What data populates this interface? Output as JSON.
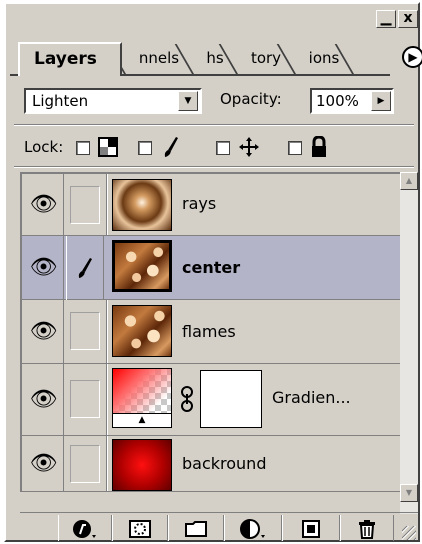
{
  "window": {
    "minimize_label": "▁",
    "close_label": "x"
  },
  "tabs": [
    {
      "label": "Layers"
    },
    {
      "label": "nnels"
    },
    {
      "label": "hs"
    },
    {
      "label": "tory"
    },
    {
      "label": "ions"
    }
  ],
  "panel_menu_icon": "triangle-right-icon",
  "blend_mode": {
    "value": "Lighten"
  },
  "opacity": {
    "label": "Opacity:",
    "value": "100%"
  },
  "lock": {
    "label": "Lock:",
    "options": [
      {
        "icon": "transparency-grid-icon",
        "checked": false
      },
      {
        "icon": "brush-icon",
        "checked": false
      },
      {
        "icon": "move-arrows-icon",
        "checked": false
      },
      {
        "icon": "padlock-icon",
        "checked": false
      }
    ]
  },
  "layers": [
    {
      "name": "rays",
      "visible": true,
      "selected": false
    },
    {
      "name": "center",
      "visible": true,
      "selected": true,
      "brush": true
    },
    {
      "name": "flames",
      "visible": true,
      "selected": false
    },
    {
      "name": "Gradien...",
      "visible": true,
      "selected": false,
      "linked_mask": true
    },
    {
      "name": "backround",
      "visible": true,
      "selected": false
    }
  ],
  "toolbar": [
    {
      "icon": "layer-style-icon"
    },
    {
      "icon": "layer-mask-icon"
    },
    {
      "icon": "new-layer-set-icon"
    },
    {
      "icon": "adjustment-layer-icon"
    },
    {
      "icon": "new-layer-icon"
    },
    {
      "icon": "trash-icon"
    }
  ]
}
